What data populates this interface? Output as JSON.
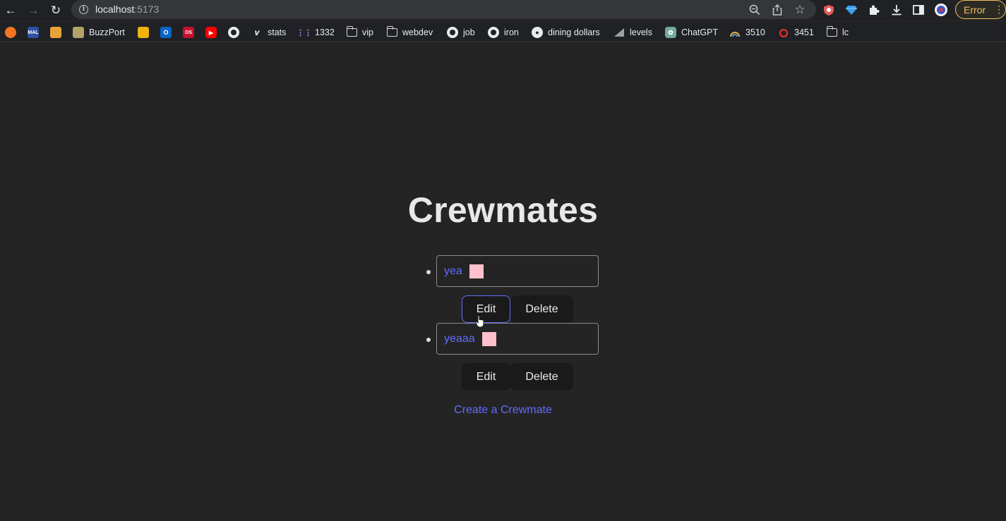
{
  "browser": {
    "url_host": "localhost",
    "url_port": ":5173",
    "error_label": "Error",
    "bookmarks": [
      {
        "label": "",
        "icon": "crunchyroll-icon",
        "color": "#f47521"
      },
      {
        "label": "",
        "icon": "mal-icon",
        "color": "#2e51a2",
        "text": "MAL"
      },
      {
        "label": "",
        "icon": "cat-icon",
        "color": "#e8a33c"
      },
      {
        "label": "BuzzPort",
        "icon": "buzz-icon",
        "color": "#b3a369"
      },
      {
        "label": "",
        "icon": "yellowjacket-icon",
        "color": "#eeb211"
      },
      {
        "label": "",
        "icon": "outlook-icon",
        "color": "#0a64c8"
      },
      {
        "label": "",
        "icon": "os-icon",
        "color": "#c8102e",
        "text": "OS"
      },
      {
        "label": "",
        "icon": "youtube-icon",
        "color": "#ff0000"
      },
      {
        "label": "",
        "icon": "github-icon"
      },
      {
        "label": "stats",
        "icon": "vercel-icon"
      },
      {
        "label": "1332",
        "icon": "dots-icon"
      },
      {
        "label": "vip",
        "icon": "folder-icon"
      },
      {
        "label": "webdev",
        "icon": "folder-icon"
      },
      {
        "label": "job",
        "icon": "github-icon"
      },
      {
        "label": "iron",
        "icon": "github-icon"
      },
      {
        "label": "dining dollars",
        "icon": "globe-icon"
      },
      {
        "label": "levels",
        "icon": "levels-icon"
      },
      {
        "label": "ChatGPT",
        "icon": "chatgpt-icon",
        "color": "#74aa9c"
      },
      {
        "label": "3510",
        "icon": "rainbow-icon"
      },
      {
        "label": "3451",
        "icon": "ring-icon",
        "color": "#e03030"
      },
      {
        "label": "lc",
        "icon": "folder-icon"
      }
    ]
  },
  "page": {
    "title": "Crewmates",
    "crewmates": [
      {
        "name": "yea",
        "color": "#ffc0cb",
        "edit_label": "Edit",
        "delete_label": "Delete"
      },
      {
        "name": "yeaaa",
        "color": "#ffc0cb",
        "edit_label": "Edit",
        "delete_label": "Delete"
      }
    ],
    "create_link": "Create a Crewmate"
  }
}
